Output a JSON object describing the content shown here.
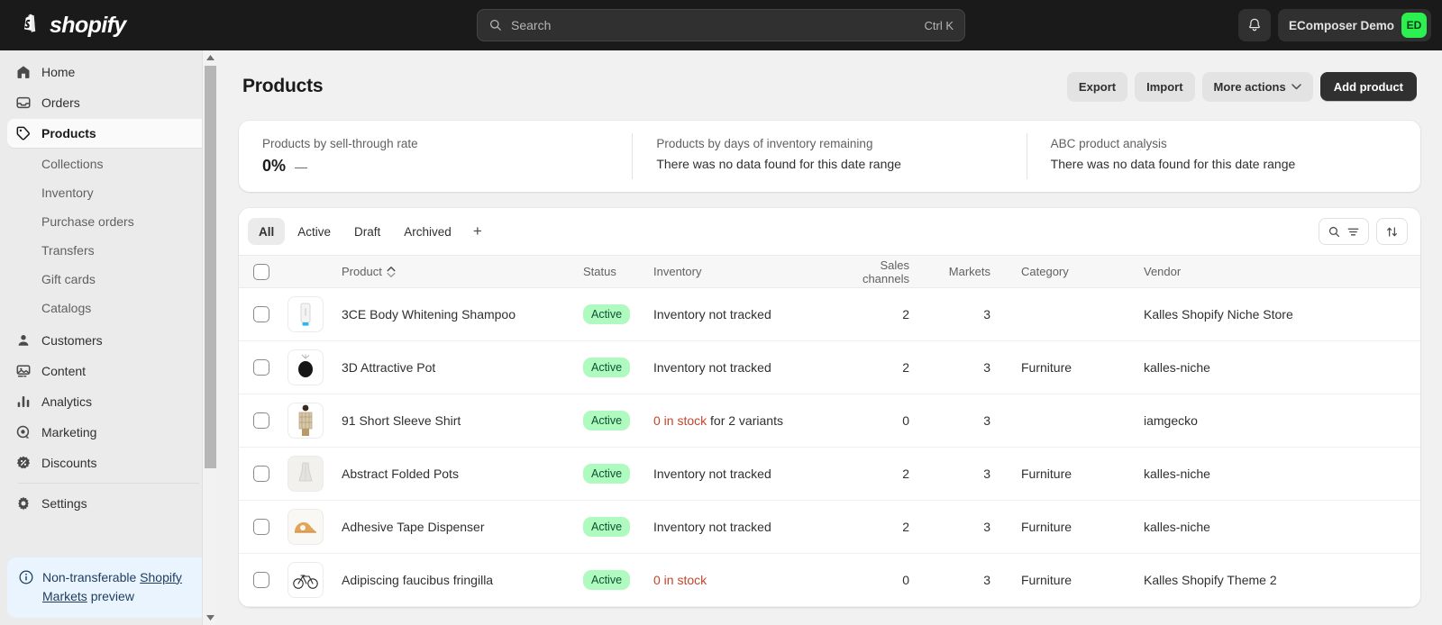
{
  "topbar": {
    "brand_name": "shopify",
    "search": {
      "placeholder": "Search",
      "shortcut": "Ctrl K"
    },
    "store_name": "EComposer Demo",
    "avatar_initials": "ED"
  },
  "sidebar": {
    "primary": [
      {
        "label": "Home",
        "icon": "home-icon",
        "key": "home"
      },
      {
        "label": "Orders",
        "icon": "orders-icon",
        "key": "orders"
      },
      {
        "label": "Products",
        "icon": "products-tag-icon",
        "key": "products",
        "selected": true
      }
    ],
    "product_subitems": [
      {
        "label": "Collections",
        "key": "collections"
      },
      {
        "label": "Inventory",
        "key": "inventory"
      },
      {
        "label": "Purchase orders",
        "key": "purchase-orders"
      },
      {
        "label": "Transfers",
        "key": "transfers"
      },
      {
        "label": "Gift cards",
        "key": "gift-cards"
      },
      {
        "label": "Catalogs",
        "key": "catalogs"
      }
    ],
    "secondary": [
      {
        "label": "Customers",
        "icon": "customers-icon",
        "key": "customers"
      },
      {
        "label": "Content",
        "icon": "content-image-icon",
        "key": "content"
      },
      {
        "label": "Analytics",
        "icon": "analytics-bars-icon",
        "key": "analytics"
      },
      {
        "label": "Marketing",
        "icon": "marketing-target-icon",
        "key": "marketing"
      },
      {
        "label": "Discounts",
        "icon": "discounts-icon",
        "key": "discounts"
      }
    ],
    "settings": {
      "label": "Settings",
      "icon": "gear-icon",
      "key": "settings"
    },
    "markets_banner": {
      "line1": "Non-transferable",
      "link": "Shopify Markets",
      "line3": "preview"
    }
  },
  "page": {
    "title": "Products",
    "actions": {
      "export": "Export",
      "import": "Import",
      "more_actions": "More actions",
      "add_product": "Add product"
    }
  },
  "stats": [
    {
      "label": "Products by sell-through rate",
      "value": "0%",
      "delta": "—",
      "empty": ""
    },
    {
      "label": "Products by days of inventory remaining",
      "value": "",
      "delta": "",
      "empty": "There was no data found for this date range"
    },
    {
      "label": "ABC product analysis",
      "value": "",
      "delta": "",
      "empty": "There was no data found for this date range"
    }
  ],
  "table": {
    "tabs": [
      {
        "label": "All",
        "active": true
      },
      {
        "label": "Active",
        "active": false
      },
      {
        "label": "Draft",
        "active": false
      },
      {
        "label": "Archived",
        "active": false
      }
    ],
    "tab_add": "+",
    "columns": {
      "product": "Product",
      "status": "Status",
      "inventory": "Inventory",
      "sales_channels": "Sales channels",
      "markets": "Markets",
      "category": "Category",
      "vendor": "Vendor"
    },
    "rows": [
      {
        "name": "3CE Body Whitening Shampoo",
        "thumb": "shampoo-tube-thumb",
        "status": "Active",
        "inventory_alert": "",
        "inventory_rest": "Inventory not tracked",
        "sales_channels": "2",
        "markets": "3",
        "category": "",
        "vendor": "Kalles Shopify Niche Store"
      },
      {
        "name": "3D Attractive Pot",
        "thumb": "black-pot-thumb",
        "status": "Active",
        "inventory_alert": "",
        "inventory_rest": "Inventory not tracked",
        "sales_channels": "2",
        "markets": "3",
        "category": "Furniture",
        "vendor": "kalles-niche"
      },
      {
        "name": "91 Short Sleeve Shirt",
        "thumb": "plaid-shirt-thumb",
        "status": "Active",
        "inventory_alert": "0 in stock",
        "inventory_rest": " for 2 variants",
        "sales_channels": "0",
        "markets": "3",
        "category": "",
        "vendor": "iamgecko"
      },
      {
        "name": "Abstract Folded Pots",
        "thumb": "folded-vase-thumb",
        "status": "Active",
        "inventory_alert": "",
        "inventory_rest": "Inventory not tracked",
        "sales_channels": "2",
        "markets": "3",
        "category": "Furniture",
        "vendor": "kalles-niche"
      },
      {
        "name": "Adhesive Tape Dispenser",
        "thumb": "tape-dispenser-thumb",
        "status": "Active",
        "inventory_alert": "",
        "inventory_rest": "Inventory not tracked",
        "sales_channels": "2",
        "markets": "3",
        "category": "Furniture",
        "vendor": "kalles-niche"
      },
      {
        "name": "Adipiscing faucibus fringilla",
        "thumb": "bicycle-thumb",
        "status": "Active",
        "inventory_alert": "0 in stock",
        "inventory_rest": "",
        "sales_channels": "0",
        "markets": "3",
        "category": "Furniture",
        "vendor": "Kalles Shopify Theme 2"
      }
    ]
  },
  "colors": {
    "topbar_bg": "#1a1a1a",
    "sidebar_bg": "#ebebeb",
    "canvas_bg": "#f1f1f1",
    "accent_green": "#2bf04f",
    "badge_bg": "#affabe",
    "badge_text": "#0c5132",
    "alert_red": "#c4452b",
    "banner_bg": "#eaf4ff"
  }
}
